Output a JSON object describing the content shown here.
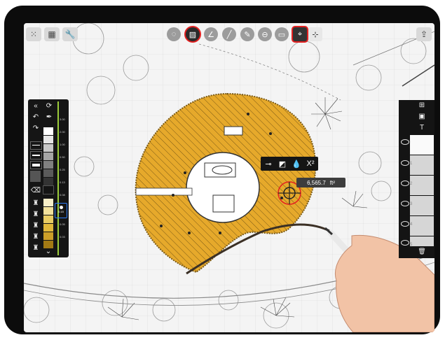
{
  "app": {
    "toolbar_left": [
      {
        "icon": "keypad-icon",
        "glyph": "⁙"
      },
      {
        "icon": "grid-view-icon",
        "glyph": "▦"
      },
      {
        "icon": "wrench-icon",
        "glyph": "🔧"
      }
    ],
    "toolbar_center": [
      {
        "icon": "pattern-fill-icon",
        "glyph": "◌",
        "selected": false
      },
      {
        "icon": "hatch-fill-icon",
        "glyph": "▨",
        "selected": true
      },
      {
        "icon": "angle-tool-icon",
        "glyph": "∠",
        "selected": false
      },
      {
        "icon": "line-tool-icon",
        "glyph": "╱",
        "selected": false
      },
      {
        "icon": "pencil-tool-icon",
        "glyph": "✎",
        "selected": false
      },
      {
        "icon": "shape-tool-icon",
        "glyph": "⊖",
        "selected": false
      },
      {
        "icon": "text-box-icon",
        "glyph": "▭",
        "selected": false
      },
      {
        "icon": "snap-crosshair-icon",
        "glyph": "⌖",
        "selected": true
      },
      {
        "icon": "snap-grid-icon",
        "glyph": "⊹",
        "selected": false
      }
    ],
    "share_icon": "⇪"
  },
  "palette": {
    "collapse_glyph": "«",
    "undo_glyph": "↶",
    "redo_glyph": "↷",
    "refresh_glyph": "⟳",
    "eyedropper_glyph": "✒",
    "size_labels": [
      "3.00",
      "2.00",
      "1.00",
      "0.50",
      "0.25",
      "0.13",
      "0.08",
      "0.05",
      "0.03"
    ],
    "selected_size": "0.15",
    "expand_glyph": "⌄",
    "grays": [
      "#ffffff",
      "#e6e6e6",
      "#c8c8c8",
      "#a6a6a6",
      "#808080",
      "#5a5a5a",
      "#333333",
      "#141414"
    ],
    "yellows": [
      "#f7eec7",
      "#f1e09a",
      "#e8cc62",
      "#e0b83a",
      "#cc9f28",
      "#a37a14"
    ]
  },
  "context_menu": {
    "items": [
      "⊸",
      "◩",
      "💧",
      "X²"
    ]
  },
  "measurement": {
    "value": "6,565.7",
    "unit": "ft²"
  },
  "layers": {
    "add_glyph": "⊞",
    "image_glyph": "▣",
    "text_glyph": "T",
    "more_glyph": "•••",
    "layer_items": [
      "",
      "1",
      "2",
      "3",
      "4",
      "5"
    ],
    "trash_glyph": "🗑"
  },
  "colors": {
    "fill": "#e6a92b",
    "hatch": "#7b5a15",
    "accent": "#e32020"
  }
}
